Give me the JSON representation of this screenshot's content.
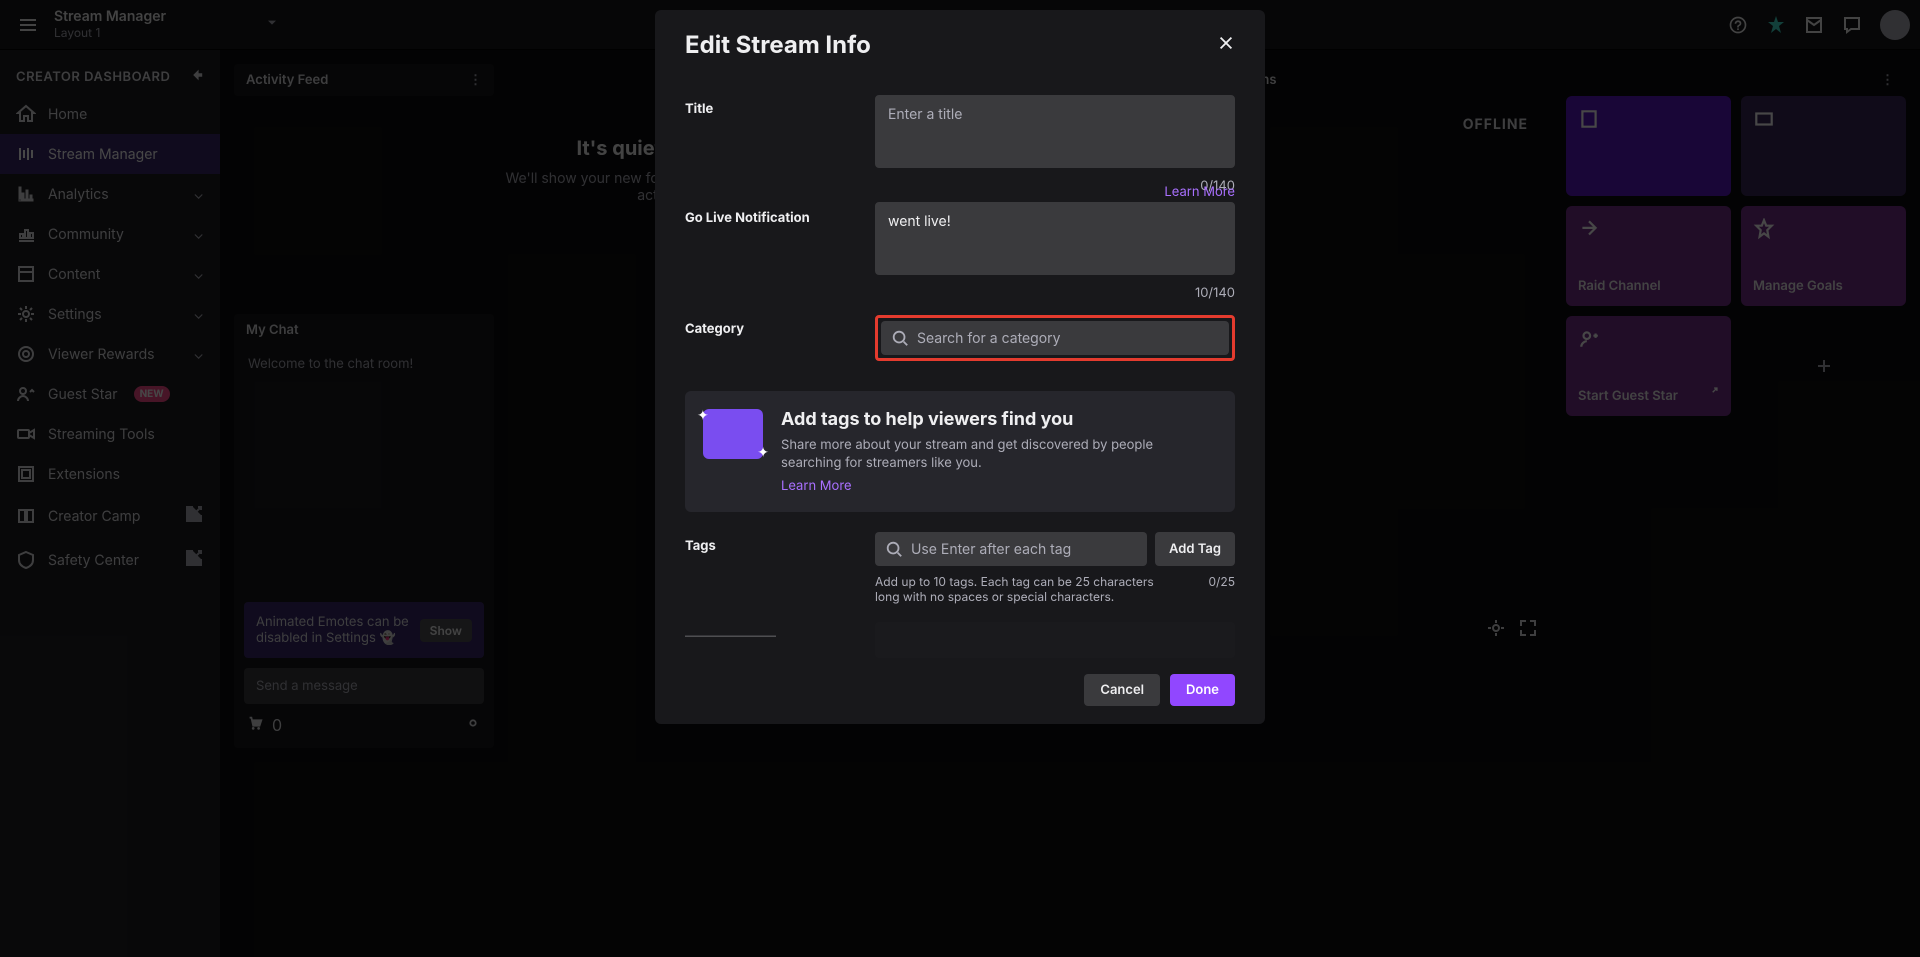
{
  "topbar": {
    "title": "Stream Manager",
    "subtitle": "Layout 1"
  },
  "sidebar": {
    "heading": "CREATOR DASHBOARD",
    "items": [
      {
        "label": "Home"
      },
      {
        "label": "Stream Manager"
      },
      {
        "label": "Analytics"
      },
      {
        "label": "Community"
      },
      {
        "label": "Content"
      },
      {
        "label": "Settings"
      },
      {
        "label": "Viewer Rewards"
      },
      {
        "label": "Guest Star"
      },
      {
        "label": "Streaming Tools"
      },
      {
        "label": "Extensions"
      },
      {
        "label": "Creator Camp"
      },
      {
        "label": "Safety Center"
      }
    ],
    "new_badge": "NEW"
  },
  "activity": {
    "heading": "Activity Feed",
    "title": "It's quiet. Too quiet...",
    "desc": "We'll show your new follows, subs, cheers, and raids activity here."
  },
  "chat": {
    "heading": "My Chat",
    "welcome": "Welcome to the chat room!",
    "notice": "Animated Emotes can be disabled in Settings 👻",
    "show_btn": "Show",
    "placeholder": "Send a message",
    "points": "0"
  },
  "preview": {
    "status": "OFFLINE",
    "pill": "OFFLINE"
  },
  "quick": {
    "heading": "Quick Actions",
    "cards": [
      {},
      {
        "label": ""
      },
      {
        "label": "Raid Channel"
      },
      {
        "label": "Manage Goals"
      },
      {
        "label": "Start Guest Star"
      }
    ]
  },
  "modal": {
    "title": "Edit Stream Info",
    "f_title": "Title",
    "title_ph": "Enter a title",
    "title_counter": "0/140",
    "f_notif": "Go Live Notification",
    "notif_lm": "Learn More",
    "notif_val": "went live!",
    "notif_counter": "10/140",
    "f_cat": "Category",
    "cat_ph": "Search for a category",
    "info_h": "Add tags to help viewers find you",
    "info_p": "Share more about your stream and get discovered by people searching for streamers like you.",
    "info_lm": "Learn More",
    "f_tags": "Tags",
    "tags_ph": "Use Enter after each tag",
    "addtag": "Add Tag",
    "tags_hint": "Add up to 10 tags. Each tag can be 25 characters long with no spaces or special characters.",
    "tags_counter": "0/25",
    "cancel": "Cancel",
    "done": "Done"
  }
}
